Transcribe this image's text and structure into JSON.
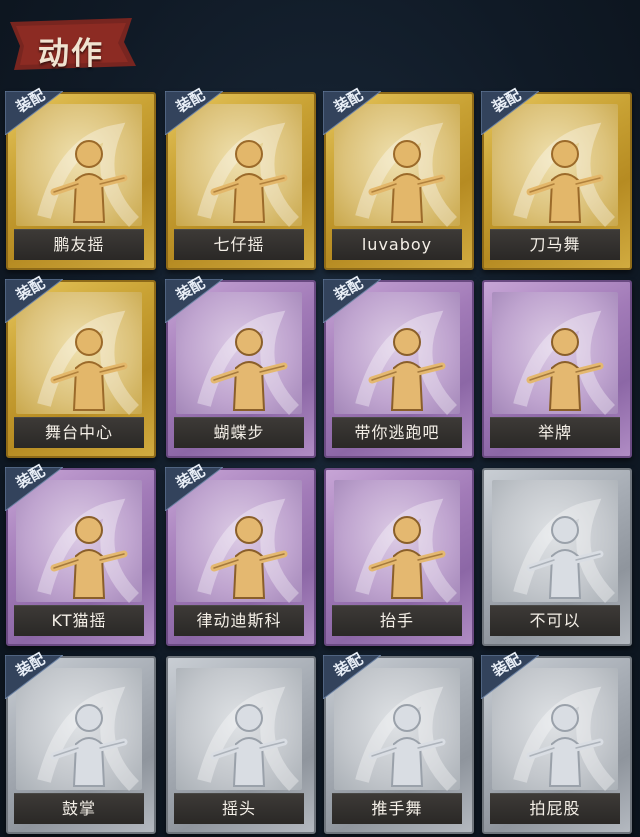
{
  "header": {
    "title": "动作"
  },
  "equip_label": "装配",
  "cards": [
    {
      "label": "鹏友摇",
      "tier": "gold",
      "equipped": true,
      "icon": "dance-pose-cross-arms-icon"
    },
    {
      "label": "七仔摇",
      "tier": "gold",
      "equipped": true,
      "icon": "dance-pose-arm-wave-icon"
    },
    {
      "label": "luvaboy",
      "tier": "gold",
      "equipped": true,
      "icon": "dance-pose-dab-icon"
    },
    {
      "label": "刀马舞",
      "tier": "gold",
      "equipped": true,
      "icon": "dance-pose-sway-icon"
    },
    {
      "label": "舞台中心",
      "tier": "gold",
      "equipped": true,
      "icon": "dance-pose-sparkle-icon"
    },
    {
      "label": "蝴蝶步",
      "tier": "purple",
      "equipped": true,
      "icon": "dance-pose-point-icon"
    },
    {
      "label": "带你逃跑吧",
      "tier": "purple",
      "equipped": true,
      "icon": "dance-pose-run-icon"
    },
    {
      "label": "举牌",
      "tier": "purple",
      "equipped": false,
      "icon": "hold-sign-icon"
    },
    {
      "label": "KT猫摇",
      "tier": "purple",
      "equipped": true,
      "icon": "dance-pose-music-icon"
    },
    {
      "label": "律动迪斯科",
      "tier": "purple",
      "equipped": true,
      "icon": "dance-pose-disco-icon"
    },
    {
      "label": "抬手",
      "tier": "purple",
      "equipped": false,
      "icon": "raise-hand-icon"
    },
    {
      "label": "不可以",
      "tier": "grey",
      "equipped": false,
      "icon": "finger-wag-icon"
    },
    {
      "label": "鼓掌",
      "tier": "grey",
      "equipped": true,
      "icon": "clap-hands-icon"
    },
    {
      "label": "摇头",
      "tier": "grey",
      "equipped": false,
      "icon": "shake-head-icon"
    },
    {
      "label": "推手舞",
      "tier": "grey",
      "equipped": true,
      "icon": "push-hand-dance-icon"
    },
    {
      "label": "拍屁股",
      "tier": "grey",
      "equipped": true,
      "icon": "butt-slap-icon"
    }
  ],
  "colors": {
    "gold": "#c9a234",
    "purple": "#a27bb8",
    "grey": "#a6acb4",
    "equip_badge": "#3a4a63",
    "title_tag": "#8e2b22"
  }
}
